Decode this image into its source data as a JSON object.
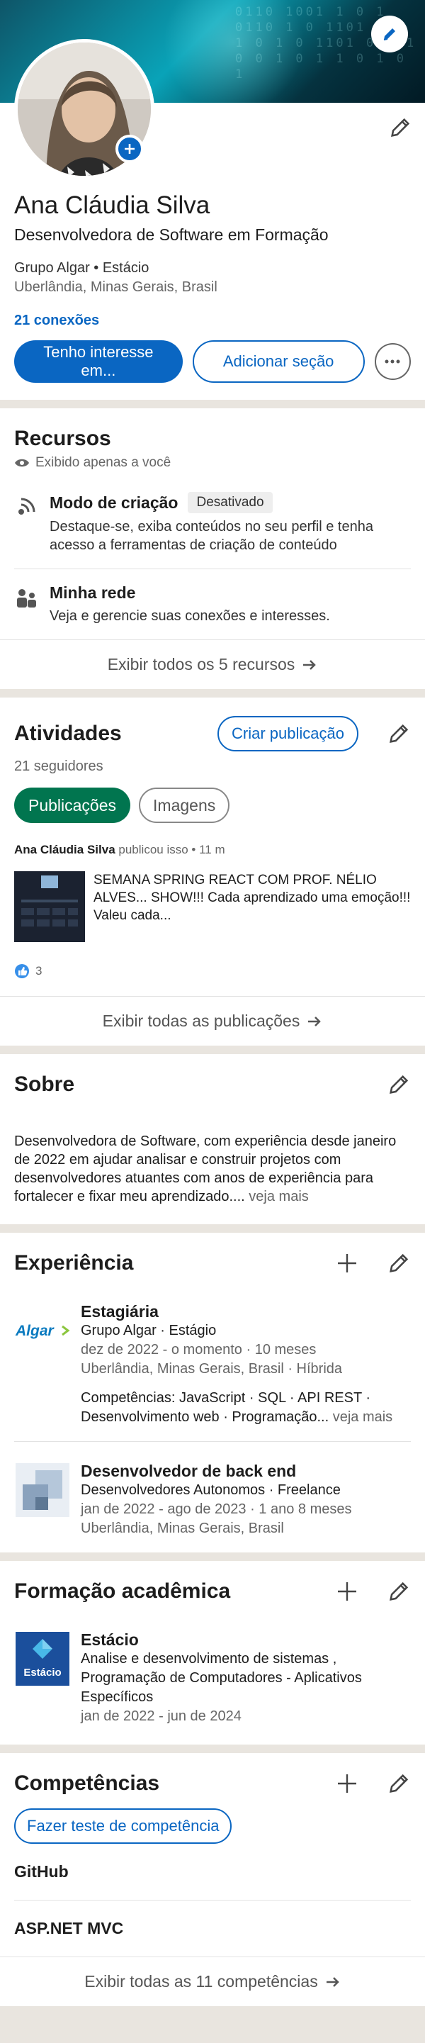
{
  "profile": {
    "name": "Ana Cláudia Silva",
    "headline": "Desenvolvedora de Software em Formação",
    "org": "Grupo Algar • Estácio",
    "location": "Uberlândia, Minas Gerais, Brasil",
    "connections": "21 conexões",
    "primary_button": "Tenho interesse em...",
    "secondary_button": "Adicionar seção",
    "binary_text": "0110 1001 1 0 1 0110 1 0 1101 1 0 1 0 1 0 1101 0 1 1 0 0 1 0 1 1 0 1 0 1"
  },
  "resources": {
    "title": "Recursos",
    "private_note": "Exibido apenas a você",
    "items": [
      {
        "title": "Modo de criação",
        "badge": "Desativado",
        "desc": "Destaque-se, exiba conteúdos no seu perfil e tenha acesso a ferramentas de criação de conteúdo"
      },
      {
        "title": "Minha rede",
        "desc": "Veja e gerencie suas conexões e interesses."
      }
    ],
    "footer": "Exibir todos os 5 recursos"
  },
  "activity": {
    "title": "Atividades",
    "create_button": "Criar publicação",
    "followers": "21 seguidores",
    "tabs": [
      "Publicações",
      "Imagens"
    ],
    "post_author": "Ana Cláudia Silva",
    "post_meta": " publicou isso • 11 m",
    "post_text": "SEMANA SPRING REACT COM PROF. NÉLIO ALVES... SHOW!!! Cada aprendizado uma emoção!!! Valeu cada...",
    "reactions_count": "3",
    "footer": "Exibir todas as publicações"
  },
  "about": {
    "title": "Sobre",
    "text": "Desenvolvedora de Software, com experiência desde janeiro de 2022 em ajudar analisar e construir projetos com desenvolvedores atuantes com anos de experiência para fortalecer e fixar meu aprendizado....",
    "see_more": " veja mais"
  },
  "experience": {
    "title": "Experiência",
    "items": [
      {
        "logo": "Algar",
        "title": "Estagiária",
        "company": "Grupo Algar · Estágio",
        "dates": "dez de 2022 - o momento · 10 meses",
        "location": "Uberlândia, Minas Gerais, Brasil · Híbrida",
        "skills": "Competências: JavaScript · SQL · API REST · Desenvolvimento web · Programação...",
        "see_more": " veja mais"
      },
      {
        "title": "Desenvolvedor de back end",
        "company": "Desenvolvedores Autonomos · Freelance",
        "dates": "jan de 2022 - ago de 2023 · 1 ano 8 meses",
        "location": "Uberlândia, Minas Gerais, Brasil"
      }
    ]
  },
  "education": {
    "title": "Formação acadêmica",
    "items": [
      {
        "logo": "Estácio",
        "school": "Estácio",
        "course": "Analise e desenvolvimento de sistemas , Programação de Computadores - Aplicativos Específicos",
        "dates": "jan de 2022 - jun de 2024"
      }
    ]
  },
  "skills": {
    "title": "Competências",
    "test_button": "Fazer teste de competência",
    "items": [
      "GitHub",
      "ASP.NET MVC"
    ],
    "footer": "Exibir todas as 11 competências"
  },
  "colors": {
    "brand_blue": "#0a66c2",
    "green_chip": "#01754f",
    "background": "#e9e5df"
  }
}
